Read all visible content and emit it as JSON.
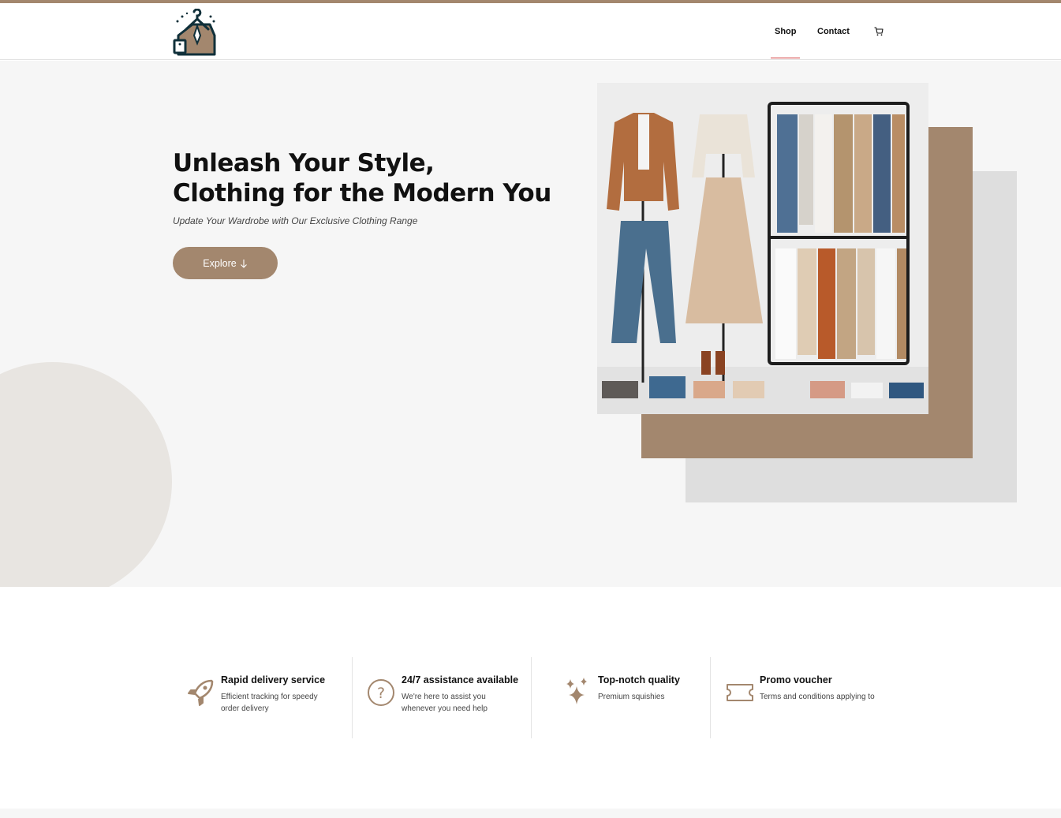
{
  "brand": {
    "logo_icon": "hanger-shirt-logo",
    "accent_color": "#a3876e",
    "nav_indicator_color": "#d23d3d"
  },
  "nav": {
    "items": [
      {
        "label": "Shop",
        "active": true
      },
      {
        "label": "Contact",
        "active": false
      }
    ],
    "cart_icon": "cart-icon"
  },
  "hero": {
    "title": "Unleash Your Style, Clothing for the Modern You",
    "subtitle": "Update Your Wardrobe with Our Exclusive Clothing Range",
    "cta_label": "Explore",
    "cta_icon": "arrow-down-icon",
    "image_subject": "clothing-rack-photo"
  },
  "features": [
    {
      "icon": "rocket-icon",
      "title": "Rapid delivery service",
      "desc": "Efficient tracking for speedy order delivery"
    },
    {
      "icon": "question-circle-icon",
      "title": "24/7 assistance available",
      "desc": "We're here to assist you whenever you need help"
    },
    {
      "icon": "sparkles-icon",
      "title": "Top-notch quality",
      "desc": "Premium squishies"
    },
    {
      "icon": "ticket-icon",
      "title": "Promo voucher",
      "desc": "Terms and conditions applying to"
    }
  ]
}
